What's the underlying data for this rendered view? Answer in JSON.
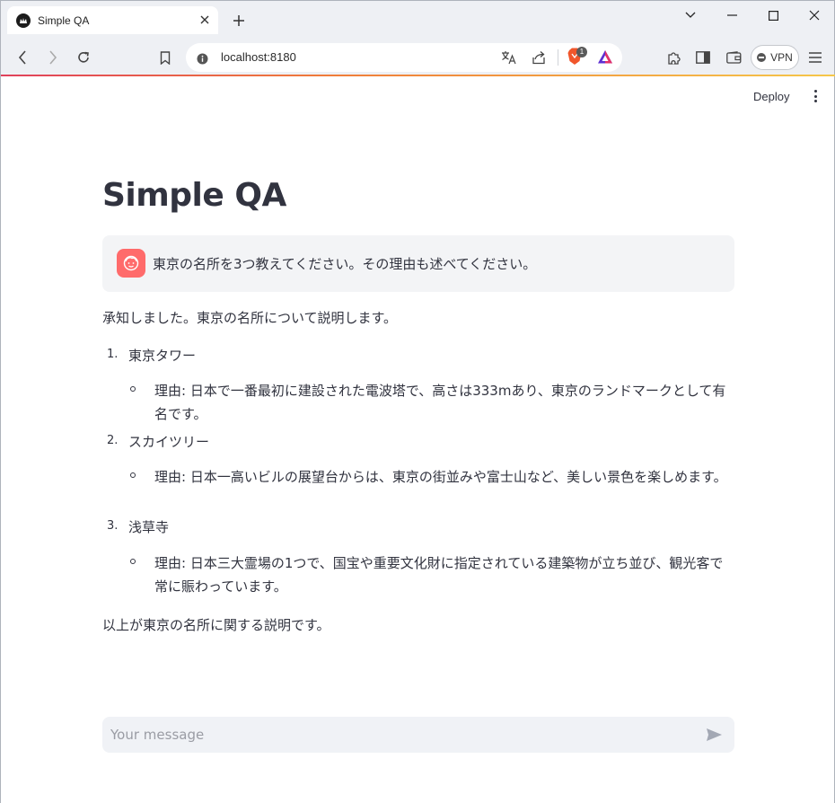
{
  "browser": {
    "tab_title": "Simple QA",
    "url": "localhost:8180",
    "shield_badge": "1",
    "vpn_label": "VPN",
    "icons": [
      "streamlit-favicon",
      "close-icon",
      "plus-icon",
      "chevron-down-icon",
      "minimize-icon",
      "maximize-icon",
      "window-close-icon",
      "back-arrow-icon",
      "forward-arrow-icon",
      "reload-icon",
      "bookmark-icon",
      "site-info-icon",
      "translate-icon",
      "share-icon",
      "brave-shield-icon",
      "brave-rewards-icon",
      "extensions-icon",
      "sidebar-icon",
      "wallet-icon",
      "menu-icon",
      "send-icon"
    ]
  },
  "app": {
    "deploy_label": "Deploy",
    "title": "Simple QA",
    "user_message": "東京の名所を3つ教えてください。その理由も述べてください。",
    "answer": {
      "intro": "承知しました。東京の名所について説明します。",
      "items": [
        {
          "number": "1.",
          "name": "東京タワー",
          "reason": "理由: 日本で一番最初に建設された電波塔で、高さは333mあり、東京のランドマークとして有名です。"
        },
        {
          "number": "2.",
          "name": "スカイツリー",
          "reason": "理由: 日本一高いビルの展望台からは、東京の街並みや富士山など、美しい景色を楽しめます。"
        },
        {
          "number": "3.",
          "name": "浅草寺",
          "reason": "理由: 日本三大霊場の1つで、国宝や重要文化財に指定されている建築物が立ち並び、観光客で常に賑わっています。"
        }
      ],
      "outro": "以上が東京の名所に関する説明です。"
    },
    "chat_input": {
      "placeholder": "Your message",
      "value": ""
    }
  },
  "colors": {
    "text": "#31333f",
    "avatar": "#ff6b6b",
    "user_bubble": "#f3f4f6",
    "input_bg": "#f0f2f6",
    "header_gradient": [
      "#e0415b",
      "#f07d3a",
      "#f5c74a"
    ]
  }
}
